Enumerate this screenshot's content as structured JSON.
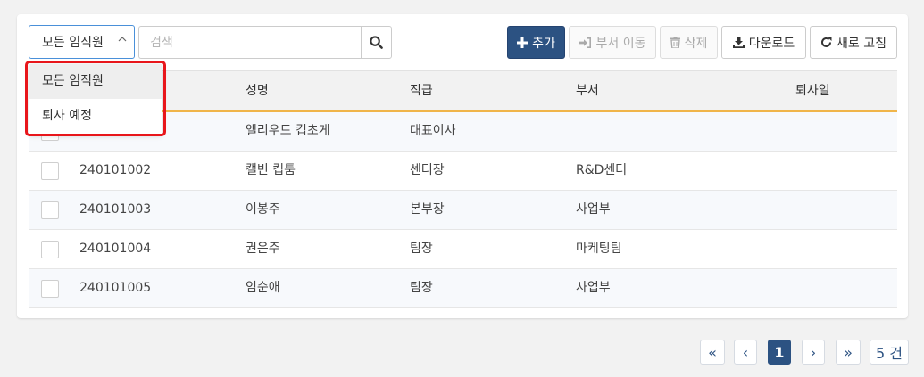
{
  "filter": {
    "selected": "모든 임직원",
    "options": [
      "모든 임직원",
      "퇴사 예정"
    ]
  },
  "search": {
    "placeholder": "검색",
    "value": ""
  },
  "toolbar": {
    "add_label": "추가",
    "move_label": "부서 이동",
    "delete_label": "삭제",
    "download_label": "다운로드",
    "refresh_label": "새로 고침"
  },
  "table": {
    "columns": [
      "성명",
      "직급",
      "부서",
      "퇴사일"
    ],
    "rows": [
      {
        "id": "",
        "name": "엘리우드 킵초게",
        "rank": "대표이사",
        "dept": "",
        "leave": ""
      },
      {
        "id": "240101002",
        "name": "캘빈 킵툼",
        "rank": "센터장",
        "dept": "R&D센터",
        "leave": ""
      },
      {
        "id": "240101003",
        "name": "이봉주",
        "rank": "본부장",
        "dept": "사업부",
        "leave": ""
      },
      {
        "id": "240101004",
        "name": "권은주",
        "rank": "팀장",
        "dept": "마케팅팀",
        "leave": ""
      },
      {
        "id": "240101005",
        "name": "임순애",
        "rank": "팀장",
        "dept": "사업부",
        "leave": ""
      }
    ]
  },
  "pagination": {
    "first": "«",
    "prev": "‹",
    "current": "1",
    "next": "›",
    "last": "»",
    "count": "5 건"
  },
  "colors": {
    "primary": "#2c5282",
    "header_accent": "#f0b54a",
    "highlight": "#e8161b"
  }
}
